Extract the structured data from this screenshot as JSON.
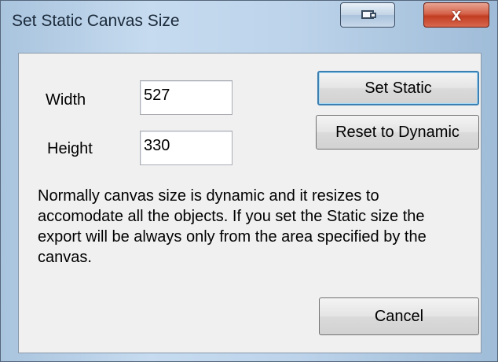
{
  "window": {
    "title": "Set Static Canvas Size",
    "close_glyph": "x"
  },
  "fields": {
    "width_label": "Width",
    "width_value": "527",
    "height_label": "Height",
    "height_value": "330"
  },
  "buttons": {
    "set_static": "Set Static",
    "reset_dynamic": "Reset to Dynamic",
    "cancel": "Cancel"
  },
  "description": {
    "line1": "Normally canvas size is dynamic and it resizes to",
    "line2": "accomodate all the objects. If you set the Static size the",
    "line3": "export will be always only from the area specified by the",
    "line4": "canvas."
  },
  "icons": {
    "restore": "restore-icon",
    "close": "close-icon"
  },
  "colors": {
    "titlebar": "#bcd3ea",
    "close_button": "#c23d22",
    "client_bg": "#f0f0f0",
    "default_button_border": "#3c7fb1"
  }
}
